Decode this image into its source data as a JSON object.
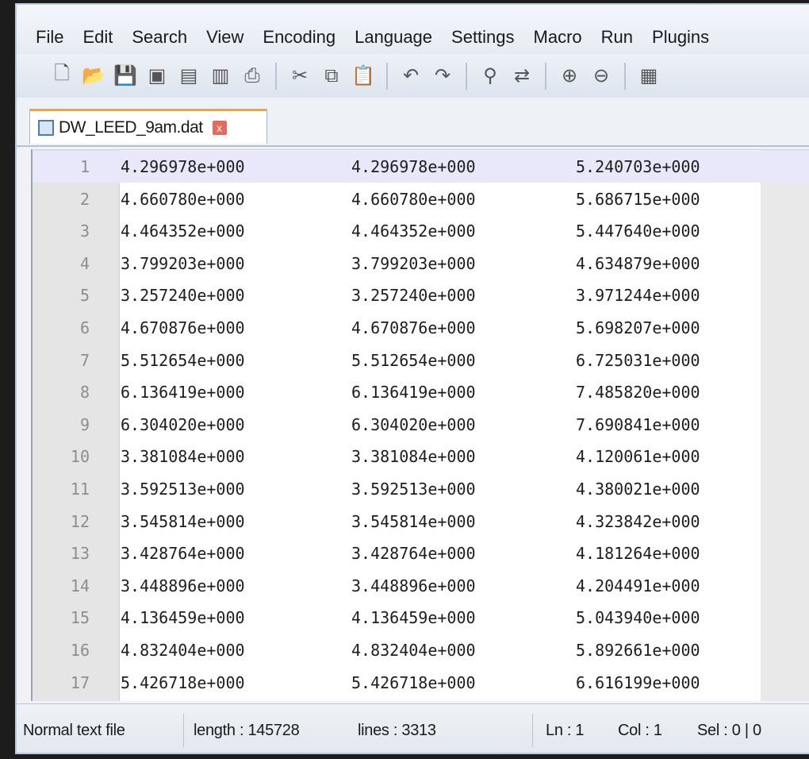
{
  "menu": [
    "File",
    "Edit",
    "Search",
    "View",
    "Encoding",
    "Language",
    "Settings",
    "Macro",
    "Run",
    "Plugins"
  ],
  "toolbar_icons": [
    "new-file-icon",
    "open-file-icon",
    "save-icon",
    "save-all-icon",
    "close-icon",
    "close-all-icon",
    "print-icon",
    "sep",
    "cut-icon",
    "copy-icon",
    "paste-icon",
    "sep",
    "undo-icon",
    "redo-icon",
    "sep",
    "find-icon",
    "replace-icon",
    "sep",
    "zoom-in-icon",
    "zoom-out-icon",
    "sep",
    "sync-icon"
  ],
  "tab": {
    "name": "DW_LEED_9am.dat",
    "close": "x"
  },
  "lines": [
    {
      "n": "1",
      "a": "4.296978e+000",
      "b": "4.296978e+000",
      "c": "5.240703e+000"
    },
    {
      "n": "2",
      "a": "4.660780e+000",
      "b": "4.660780e+000",
      "c": "5.686715e+000"
    },
    {
      "n": "3",
      "a": "4.464352e+000",
      "b": "4.464352e+000",
      "c": "5.447640e+000"
    },
    {
      "n": "4",
      "a": "3.799203e+000",
      "b": "3.799203e+000",
      "c": "4.634879e+000"
    },
    {
      "n": "5",
      "a": "3.257240e+000",
      "b": "3.257240e+000",
      "c": "3.971244e+000"
    },
    {
      "n": "6",
      "a": "4.670876e+000",
      "b": "4.670876e+000",
      "c": "5.698207e+000"
    },
    {
      "n": "7",
      "a": "5.512654e+000",
      "b": "5.512654e+000",
      "c": "6.725031e+000"
    },
    {
      "n": "8",
      "a": "6.136419e+000",
      "b": "6.136419e+000",
      "c": "7.485820e+000"
    },
    {
      "n": "9",
      "a": "6.304020e+000",
      "b": "6.304020e+000",
      "c": "7.690841e+000"
    },
    {
      "n": "10",
      "a": "3.381084e+000",
      "b": "3.381084e+000",
      "c": "4.120061e+000"
    },
    {
      "n": "11",
      "a": "3.592513e+000",
      "b": "3.592513e+000",
      "c": "4.380021e+000"
    },
    {
      "n": "12",
      "a": "3.545814e+000",
      "b": "3.545814e+000",
      "c": "4.323842e+000"
    },
    {
      "n": "13",
      "a": "3.428764e+000",
      "b": "3.428764e+000",
      "c": "4.181264e+000"
    },
    {
      "n": "14",
      "a": "3.448896e+000",
      "b": "3.448896e+000",
      "c": "4.204491e+000"
    },
    {
      "n": "15",
      "a": "4.136459e+000",
      "b": "4.136459e+000",
      "c": "5.043940e+000"
    },
    {
      "n": "16",
      "a": "4.832404e+000",
      "b": "4.832404e+000",
      "c": "5.892661e+000"
    },
    {
      "n": "17",
      "a": "5.426718e+000",
      "b": "5.426718e+000",
      "c": "6.616199e+000"
    }
  ],
  "status": {
    "type": "Normal text file",
    "length": "length : 145728",
    "lines": "lines : 3313",
    "ln": "Ln : 1",
    "col": "Col : 1",
    "sel": "Sel : 0 | 0"
  }
}
